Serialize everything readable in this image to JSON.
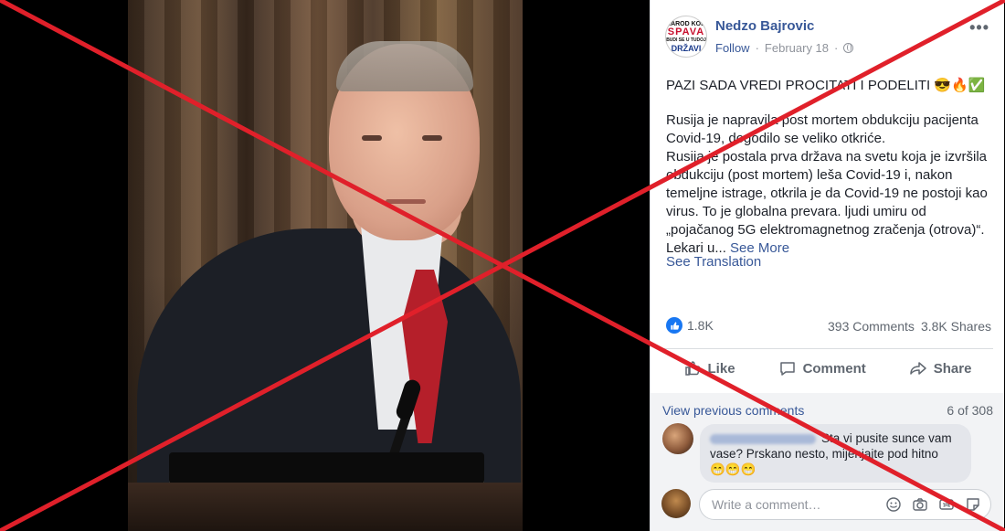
{
  "post": {
    "page_avatar_text": [
      "NAROD KOJI",
      "SPAVA",
      "BUDI SE U TUDOJ",
      "DRŽAVI"
    ],
    "author": "Nedzo Bajrovic",
    "follow": "Follow",
    "date": "February 18",
    "separator": "·",
    "more_icon": "•••",
    "headline": "PAZI SADA VREDI PROCITATI I PODELITI 😎🔥✅",
    "body_lines": [
      "Rusija je napravila post mortem obdukciju pacijenta Covid-19, dogodilo se veliko otkriće.",
      "Rusija je postala prva država na svetu koja je izvršila obdukciju (post mortem) leša Covid-19 i, nakon temeljne istrage, otkrila je da Covid-19 ne postoji kao virus. To je globalna prevara. ljudi umiru od „pojačanog 5G elektromagnetnog zračenja (otrova)“. Lekari u..."
    ],
    "see_more": "See More",
    "see_translation": "See Translation",
    "reactions_count": "1.8K",
    "comments_count": "393 Comments",
    "shares_count": "3.8K Shares",
    "actions": {
      "like": "Like",
      "comment": "Comment",
      "share": "Share"
    }
  },
  "comments": {
    "view_previous": "View previous comments",
    "count_of": "6 of 308",
    "items": [
      {
        "text": "Sta vi pusite sunce vam vase? Prskano nesto, mijenjajte pod hitno",
        "emojis": "😁😁😁"
      }
    ],
    "write_placeholder": "Write a comment…"
  },
  "colors": {
    "facebook_blue": "#385898",
    "overlay_red": "#e0202a"
  }
}
